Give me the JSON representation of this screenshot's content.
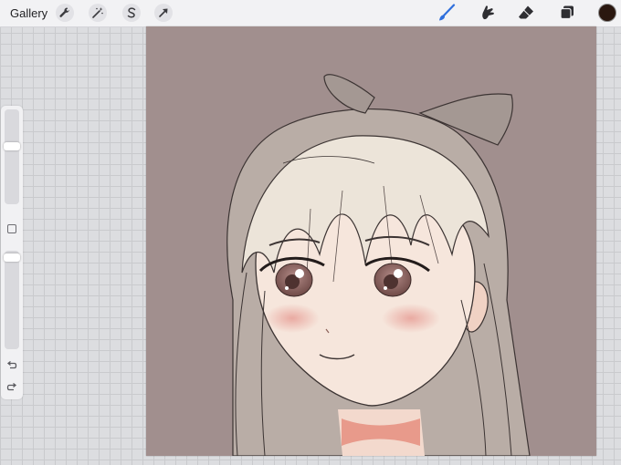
{
  "toolbar": {
    "gallery_label": "Gallery",
    "left_tools": [
      "wrench-icon",
      "magic-wand-icon",
      "selection-icon",
      "transform-arrow-icon"
    ],
    "right_tools": [
      "brush-icon",
      "smudge-icon",
      "eraser-icon",
      "layers-icon"
    ],
    "active_tool": "brush",
    "accent_color": "#2f6fdc",
    "current_color": "#2a170f"
  },
  "sidebar": {
    "brush_size": 0.6,
    "opacity": 1.0
  },
  "canvas": {
    "background_color": "#a18f8e"
  }
}
